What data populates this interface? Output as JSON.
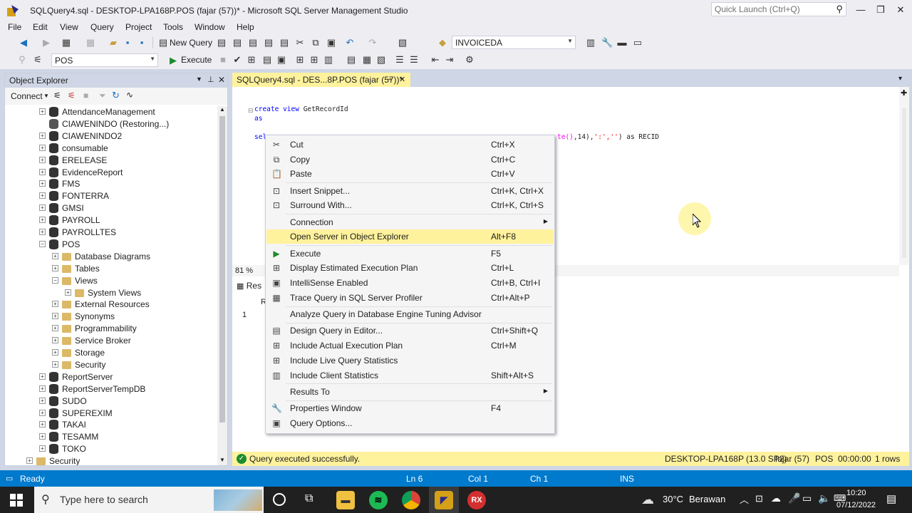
{
  "window": {
    "title": "SQLQuery4.sql - DESKTOP-LPA168P.POS (fajar (57))* - Microsoft SQL Server Management Studio",
    "quick_launch_placeholder": "Quick Launch (Ctrl+Q)"
  },
  "menu": [
    "File",
    "Edit",
    "View",
    "Query",
    "Project",
    "Tools",
    "Window",
    "Help"
  ],
  "toolbar": {
    "new_query_label": "New Query",
    "database_combo": "INVOICEDA",
    "db_selector": "POS",
    "execute_label": "Execute"
  },
  "object_explorer": {
    "title": "Object Explorer",
    "connect_label": "Connect",
    "tree": [
      {
        "label": "AttendanceManagement",
        "level": 1,
        "type": "db",
        "expanded": false
      },
      {
        "label": "CIAWENINDO (Restoring...)",
        "level": 1,
        "type": "db-restoring",
        "expanded": null
      },
      {
        "label": "CIAWENINDO2",
        "level": 1,
        "type": "db",
        "expanded": false
      },
      {
        "label": "consumable",
        "level": 1,
        "type": "db",
        "expanded": false
      },
      {
        "label": "ERELEASE",
        "level": 1,
        "type": "db",
        "expanded": false
      },
      {
        "label": "EvidenceReport",
        "level": 1,
        "type": "db",
        "expanded": false
      },
      {
        "label": "FMS",
        "level": 1,
        "type": "db",
        "expanded": false
      },
      {
        "label": "FONTERRA",
        "level": 1,
        "type": "db",
        "expanded": false
      },
      {
        "label": "GMSI",
        "level": 1,
        "type": "db",
        "expanded": false
      },
      {
        "label": "PAYROLL",
        "level": 1,
        "type": "db",
        "expanded": false
      },
      {
        "label": "PAYROLLTES",
        "level": 1,
        "type": "db",
        "expanded": false
      },
      {
        "label": "POS",
        "level": 1,
        "type": "db",
        "expanded": true
      },
      {
        "label": "Database Diagrams",
        "level": 2,
        "type": "folder",
        "expanded": false
      },
      {
        "label": "Tables",
        "level": 2,
        "type": "folder",
        "expanded": false
      },
      {
        "label": "Views",
        "level": 2,
        "type": "folder",
        "expanded": true
      },
      {
        "label": "System Views",
        "level": 3,
        "type": "folder",
        "expanded": false
      },
      {
        "label": "External Resources",
        "level": 2,
        "type": "folder",
        "expanded": false
      },
      {
        "label": "Synonyms",
        "level": 2,
        "type": "folder",
        "expanded": false
      },
      {
        "label": "Programmability",
        "level": 2,
        "type": "folder",
        "expanded": false
      },
      {
        "label": "Service Broker",
        "level": 2,
        "type": "folder",
        "expanded": false
      },
      {
        "label": "Storage",
        "level": 2,
        "type": "folder",
        "expanded": false
      },
      {
        "label": "Security",
        "level": 2,
        "type": "folder",
        "expanded": false
      },
      {
        "label": "ReportServer",
        "level": 1,
        "type": "db",
        "expanded": false
      },
      {
        "label": "ReportServerTempDB",
        "level": 1,
        "type": "db",
        "expanded": false
      },
      {
        "label": "SUDO",
        "level": 1,
        "type": "db",
        "expanded": false
      },
      {
        "label": "SUPEREXIM",
        "level": 1,
        "type": "db",
        "expanded": false
      },
      {
        "label": "TAKAI",
        "level": 1,
        "type": "db",
        "expanded": false
      },
      {
        "label": "TESAMM",
        "level": 1,
        "type": "db",
        "expanded": false
      },
      {
        "label": "TOKO",
        "level": 1,
        "type": "db",
        "expanded": false
      },
      {
        "label": "Security",
        "level": 0,
        "type": "folder",
        "expanded": false
      }
    ]
  },
  "editor": {
    "tab_label": "SQLQuery4.sql - DES...8P.POS (fajar (57))*",
    "line1_kw1": "create",
    "line1_kw2": "view",
    "line1_name": "GetRecordId",
    "line2": "as",
    "line3_start": "sel",
    "line3_fn": "te()",
    "line3_mid": ",14),",
    "line3_str": "':',''",
    "line3_end": ") as RECID",
    "zoom": "81 %",
    "results_tab": "Res",
    "grid_row_num": "1",
    "grid_col": "R"
  },
  "query_status": {
    "message": "Query executed successfully.",
    "server": "DESKTOP-LPA168P (13.0 SP2)",
    "user": "fajar (57)",
    "db": "POS",
    "time": "00:00:00",
    "rows": "1 rows"
  },
  "context_menu": [
    {
      "label": "Cut",
      "shortcut": "Ctrl+X",
      "icon": "scissors-icon",
      "glyph": "✂"
    },
    {
      "label": "Copy",
      "shortcut": "Ctrl+C",
      "icon": "copy-icon",
      "glyph": "⧉"
    },
    {
      "label": "Paste",
      "shortcut": "Ctrl+V",
      "icon": "paste-icon",
      "glyph": "📋"
    },
    {
      "label": "Insert Snippet...",
      "shortcut": "Ctrl+K, Ctrl+X",
      "icon": "snippet-icon",
      "glyph": "⊡"
    },
    {
      "label": "Surround With...",
      "shortcut": "Ctrl+K, Ctrl+S",
      "icon": "surround-icon",
      "glyph": "⊡"
    },
    {
      "label": "Connection",
      "shortcut": "",
      "icon": "",
      "glyph": "",
      "submenu": true
    },
    {
      "label": "Open Server in Object Explorer",
      "shortcut": "Alt+F8",
      "icon": "",
      "glyph": "",
      "highlighted": true
    },
    {
      "label": "Execute",
      "shortcut": "F5",
      "icon": "execute-icon",
      "glyph": "▶"
    },
    {
      "label": "Display Estimated Execution Plan",
      "shortcut": "Ctrl+L",
      "icon": "plan-icon",
      "glyph": "⊞"
    },
    {
      "label": "IntelliSense Enabled",
      "shortcut": "Ctrl+B, Ctrl+I",
      "icon": "intellisense-icon",
      "glyph": "▣"
    },
    {
      "label": "Trace Query in SQL Server Profiler",
      "shortcut": "Ctrl+Alt+P",
      "icon": "profiler-icon",
      "glyph": "▦"
    },
    {
      "label": "Analyze Query in Database Engine Tuning Advisor",
      "shortcut": "",
      "icon": "",
      "glyph": ""
    },
    {
      "label": "Design Query in Editor...",
      "shortcut": "Ctrl+Shift+Q",
      "icon": "design-icon",
      "glyph": "▤"
    },
    {
      "label": "Include Actual Execution Plan",
      "shortcut": "Ctrl+M",
      "icon": "actual-plan-icon",
      "glyph": "⊞"
    },
    {
      "label": "Include Live Query Statistics",
      "shortcut": "",
      "icon": "live-stats-icon",
      "glyph": "⊞"
    },
    {
      "label": "Include Client Statistics",
      "shortcut": "Shift+Alt+S",
      "icon": "client-stats-icon",
      "glyph": "▥"
    },
    {
      "label": "Results To",
      "shortcut": "",
      "icon": "",
      "glyph": "",
      "submenu": true
    },
    {
      "label": "Properties Window",
      "shortcut": "F4",
      "icon": "wrench-icon",
      "glyph": "🔧"
    },
    {
      "label": "Query Options...",
      "shortcut": "",
      "icon": "options-icon",
      "glyph": "▣"
    }
  ],
  "statusbar": {
    "ready": "Ready",
    "ln": "Ln 6",
    "col": "Col 1",
    "ch": "Ch 1",
    "ins": "INS"
  },
  "taskbar": {
    "search_placeholder": "Type here to search",
    "weather_temp": "30°C",
    "weather_desc": "Berawan",
    "time": "10:20",
    "date": "07/12/2022"
  },
  "colors": {
    "accent_yellow": "#fff29d",
    "status_blue": "#007acc",
    "panel_header": "#cfd6e5"
  }
}
